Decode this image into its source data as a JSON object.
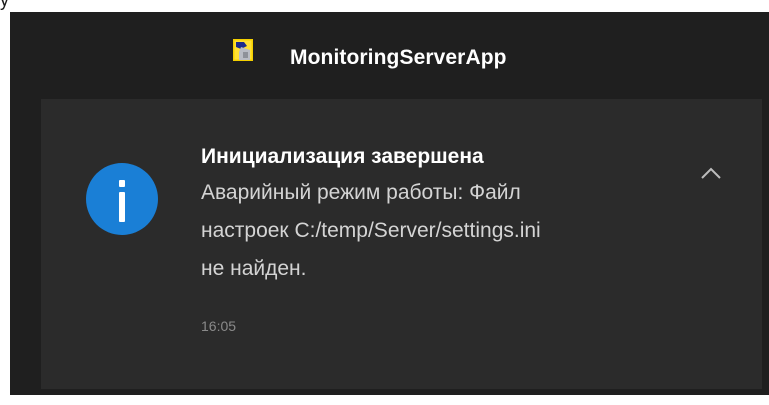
{
  "app": {
    "name": "MonitoringServerApp",
    "icon": "app-icon"
  },
  "notification": {
    "title": "Инициализация завершена",
    "body_lines": [
      "Аварийный режим работы: Файл",
      "настроек C:/temp/Server/settings.ini",
      "не найден."
    ],
    "time": "16:05",
    "icon": "info-icon",
    "collapse_icon": "chevron-up-icon"
  },
  "colors": {
    "background": "#1f1f1f",
    "toast_background": "#2b2b2b",
    "accent": "#1a7fd6"
  }
}
